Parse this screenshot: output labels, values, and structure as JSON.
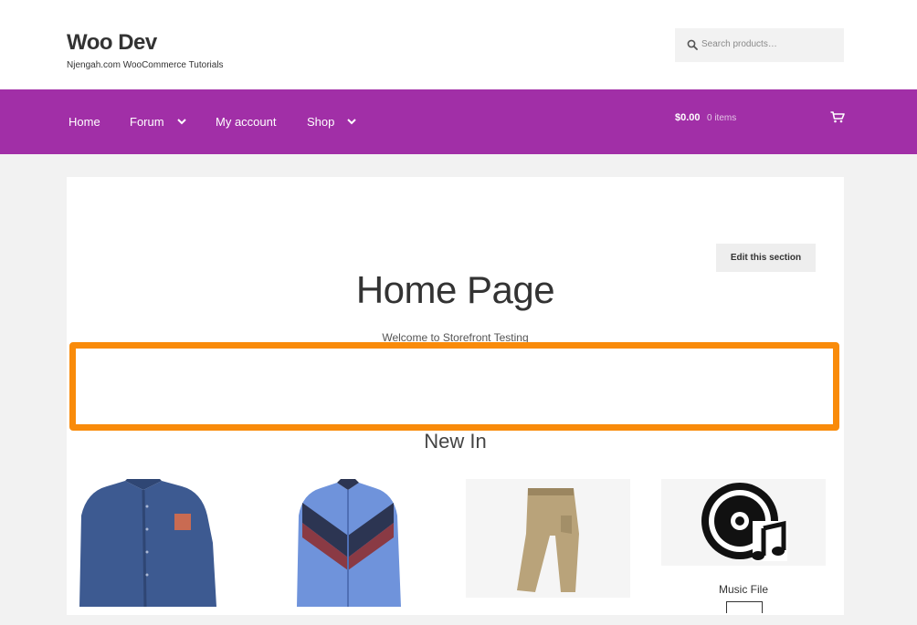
{
  "header": {
    "site_title": "Woo Dev",
    "tagline": "Njengah.com WooCommerce Tutorials",
    "search_placeholder": "Search products…"
  },
  "nav": {
    "items": [
      {
        "label": "Home",
        "has_dropdown": false
      },
      {
        "label": "Forum",
        "has_dropdown": true
      },
      {
        "label": "My account",
        "has_dropdown": false
      },
      {
        "label": "Shop",
        "has_dropdown": true
      }
    ],
    "cart_amount": "$0.00",
    "cart_count": "0 items"
  },
  "main": {
    "edit_button": "Edit this section",
    "page_title": "Home Page",
    "welcome_text": "Welcome to Storefront Testing",
    "section_title": "New In",
    "products": [
      {
        "name": ""
      },
      {
        "name": ""
      },
      {
        "name": ""
      },
      {
        "name": "Music File"
      }
    ]
  },
  "colors": {
    "nav_bg": "#a12fa7",
    "highlight": "#f98b0a"
  }
}
